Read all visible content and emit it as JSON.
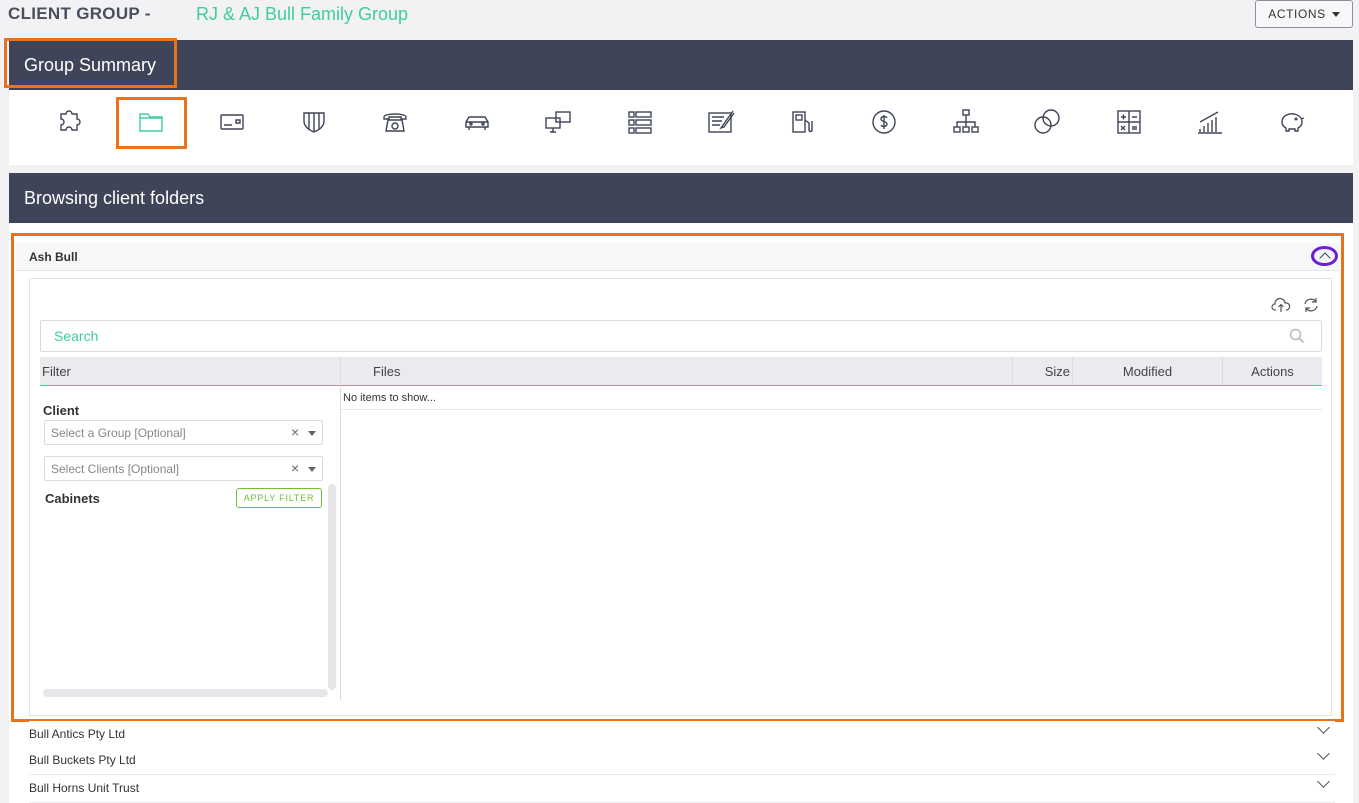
{
  "header": {
    "client_group_label": "CLIENT GROUP -",
    "client_group_name": "RJ & AJ Bull Family Group",
    "actions_label": "ACTIONS"
  },
  "group_summary": {
    "title": "Group Summary",
    "icons": [
      "puzzle-icon",
      "folder-icon",
      "id-card-icon",
      "shield-icon",
      "phone-icon",
      "car-icon",
      "monitor-transfer-icon",
      "list-icon",
      "certificate-icon",
      "fuel-pump-icon",
      "dollar-icon",
      "org-chart-icon",
      "coins-icon",
      "calculator-icon",
      "growth-chart-icon",
      "piggy-bank-icon"
    ]
  },
  "browser": {
    "title": "Browsing client folders",
    "expanded_client": "Ash Bull",
    "search_placeholder": "Search",
    "filter_header": "Filter",
    "columns": {
      "files": "Files",
      "size": "Size",
      "modified": "Modified",
      "actions": "Actions"
    },
    "empty_message": "No items to show...",
    "client_label": "Client",
    "group_select_placeholder": "Select a Group [Optional]",
    "clients_select_placeholder": "Select Clients [Optional]",
    "cabinets_label": "Cabinets",
    "apply_filter_label": "APPLY FILTER",
    "clear_symbol": "×",
    "other_clients": [
      "Bull Antics Pty Ltd",
      "Bull Buckets Pty Ltd",
      "Bull Horns Unit Trust"
    ]
  },
  "colors": {
    "accent": "#3ecf9a",
    "highlight": "#e8731c",
    "header_bg": "#3f4458",
    "focus_ring": "#6a1fd8",
    "apply": "#6fbf3a"
  }
}
